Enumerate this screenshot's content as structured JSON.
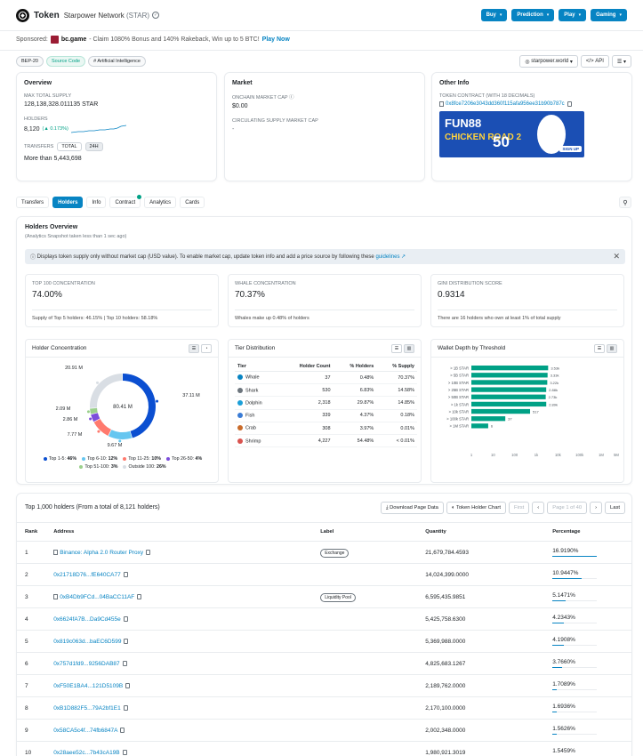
{
  "header": {
    "type": "Token",
    "name": "Starpower Network",
    "symbol": "(STAR)",
    "buttons": [
      {
        "label": "Buy"
      },
      {
        "label": "Prediction"
      },
      {
        "label": "Play"
      },
      {
        "label": "Gaming"
      }
    ]
  },
  "sponsor": {
    "prefix": "Sponsored:",
    "brand": "bc.game",
    "text": "- Claim 1080% Bonus and 140% Rakeback, Win up to 5 BTC!",
    "link": "Play Now"
  },
  "tags": [
    "BEP-20",
    "Source Code",
    "# Artificial Intelligence"
  ],
  "tools": {
    "website": "starpower.world",
    "api": "API"
  },
  "overview": {
    "title": "Overview",
    "max_supply_label": "MAX TOTAL SUPPLY",
    "max_supply": "128,138,328.011135 STAR",
    "holders_label": "HOLDERS",
    "holders": "8,120",
    "holders_change": "(▲ 0.173%)",
    "transfers_label": "TRANSFERS",
    "total_label": "TOTAL",
    "h24_label": "24H",
    "transfers": "More than 5,443,698"
  },
  "market": {
    "title": "Market",
    "onchain_label": "ONCHAIN MARKET CAP",
    "onchain": "$0.00",
    "circ_label": "CIRCULATING SUPPLY MARKET CAP",
    "circ": "-"
  },
  "other": {
    "title": "Other Info",
    "contract_label": "TOKEN CONTRACT (WITH 18 DECIMALS)",
    "contract": "0x8fce7206e3043dd360f115afa956ee31b90b787c",
    "ad_title": "FUN88",
    "ad_game": "CHICKEN ROAD 2",
    "ad_num": "50",
    "ad_cta": "SIGN UP"
  },
  "tabs": [
    "Transfers",
    "Holders",
    "Info",
    "Contract",
    "Analytics",
    "Cards"
  ],
  "holders_overview": {
    "title": "Holders Overview",
    "subtitle": "(Analytics Snapshot taken less than 1 sec ago)",
    "info": "Displays token supply only without market cap (USD value). To enable market cap, update token info and add a price source by following these",
    "info_link": "guidelines ↗",
    "stats": [
      {
        "label": "TOP 100 CONCENTRATION",
        "value": "74.00%",
        "foot": "Supply of Top 5 holders: 46.15% | Top 10 holders: 58.18%"
      },
      {
        "label": "WHALE CONCENTRATION",
        "value": "70.37%",
        "foot": "Whales make up 0.48% of holders"
      },
      {
        "label": "GINI DISTRIBUTION SCORE",
        "value": "0.9314",
        "foot": "There are 16 holders who own at least 1% of total supply"
      }
    ],
    "concentration_title": "Holder Concentration",
    "tier_title": "Tier Distribution",
    "wallet_title": "Wallet Depth by Threshold"
  },
  "tier_table": {
    "headers": [
      "Tier",
      "Holder Count",
      "% Holders",
      "% Supply"
    ],
    "rows": [
      [
        "Whale",
        "37",
        "0.48%",
        "70.37%"
      ],
      [
        "Shark",
        "530",
        "6.83%",
        "14.58%"
      ],
      [
        "Dolphin",
        "2,318",
        "29.87%",
        "14.85%"
      ],
      [
        "Fish",
        "339",
        "4.37%",
        "0.18%"
      ],
      [
        "Crab",
        "308",
        "3.97%",
        "0.01%"
      ],
      [
        "Shrimp",
        "4,227",
        "54.48%",
        "< 0.01%"
      ]
    ]
  },
  "chart_data": [
    {
      "type": "pie",
      "labels": [
        "Top 1-5",
        "Top 6-10",
        "Top 11-25",
        "Top 26-50",
        "Top 51-100",
        "Outside 100"
      ],
      "values": [
        46,
        12,
        10,
        4,
        3,
        26
      ],
      "slice_labels": [
        "37.11 M",
        "9.67 M",
        "7.77 M",
        "2.86 M",
        "2.09 M",
        "20.91 M"
      ],
      "center_label": "80.41 M",
      "legend_values": [
        "46%",
        "12%",
        "10%",
        "4%",
        "3%",
        "26%"
      ],
      "colors": [
        "#0b4fd1",
        "#66c6f0",
        "#ff7a6e",
        "#7c4ddb",
        "#9bd08c",
        "#d9dee4"
      ]
    },
    {
      "type": "bar",
      "orientation": "horizontal",
      "categories": [
        "> 1B STAR",
        "> 5B STAR",
        "> 10B STAR",
        "> 25B STAR",
        "> 50B STAR",
        "> 1k STAR",
        "> 10k STAR",
        "> 100k STAR",
        "> 1M STAR"
      ],
      "values": [
        3530,
        3330,
        3220,
        2880,
        2730,
        2890,
        517,
        37,
        6
      ],
      "value_labels": [
        "3.53k",
        "3.33k",
        "3.22k",
        "2.88k",
        "2.73k",
        "2.89k",
        "517",
        "37",
        "6"
      ],
      "x_ticks": [
        "1",
        "10",
        "100",
        "1k",
        "10k",
        "100k",
        "1M",
        "5M"
      ],
      "color": "#00a186"
    }
  ],
  "holders_table": {
    "heading": "Top 1,000 holders (From a total of 8,121 holders)",
    "download": "Download Page Data",
    "chart_btn": "Token Holder Chart",
    "first": "First",
    "page": "Page 1 of 40",
    "last": "Last",
    "headers": [
      "Rank",
      "Address",
      "Label",
      "Quantity",
      "Percentage"
    ],
    "rows": [
      {
        "rank": "1",
        "address": "Binance: Alpha 2.0 Router Proxy",
        "label": "Exchange",
        "qty": "21,679,784.4593",
        "pct": "16.9190%",
        "pv": 16.919
      },
      {
        "rank": "2",
        "address": "0x21718D76...fE640CA77",
        "label": "",
        "qty": "14,024,399.0000",
        "pct": "10.9447%",
        "pv": 10.9447
      },
      {
        "rank": "3",
        "address": "0xB4Db9FCd...04BaCC11AF",
        "label": "Liquidity Pool",
        "qty": "6,595,435.9851",
        "pct": "5.1471%",
        "pv": 5.1471
      },
      {
        "rank": "4",
        "address": "0x6624fA7B...Da9Cd455e",
        "label": "",
        "qty": "5,425,758.6300",
        "pct": "4.2343%",
        "pv": 4.2343
      },
      {
        "rank": "5",
        "address": "0x819c063d...baEC6D599",
        "label": "",
        "qty": "5,369,988.0000",
        "pct": "4.1908%",
        "pv": 4.1908
      },
      {
        "rank": "6",
        "address": "0x757d1fd9...9256DAB87",
        "label": "",
        "qty": "4,825,683.1267",
        "pct": "3.7660%",
        "pv": 3.766
      },
      {
        "rank": "7",
        "address": "0xF50E1BA4...121D5109B",
        "label": "",
        "qty": "2,189,762.0000",
        "pct": "1.7089%",
        "pv": 1.7089
      },
      {
        "rank": "8",
        "address": "0xB1D882F5...79A2bf1E1",
        "label": "",
        "qty": "2,170,100.0000",
        "pct": "1.6936%",
        "pv": 1.6936
      },
      {
        "rank": "9",
        "address": "0x58CA5c4f...74fb6847A",
        "label": "",
        "qty": "2,002,348.0000",
        "pct": "1.5626%",
        "pv": 1.5626
      },
      {
        "rank": "10",
        "address": "0x28aee52c...7b43cA19B",
        "label": "",
        "qty": "1,980,921.3019",
        "pct": "1.5459%",
        "pv": 1.5459
      }
    ]
  }
}
